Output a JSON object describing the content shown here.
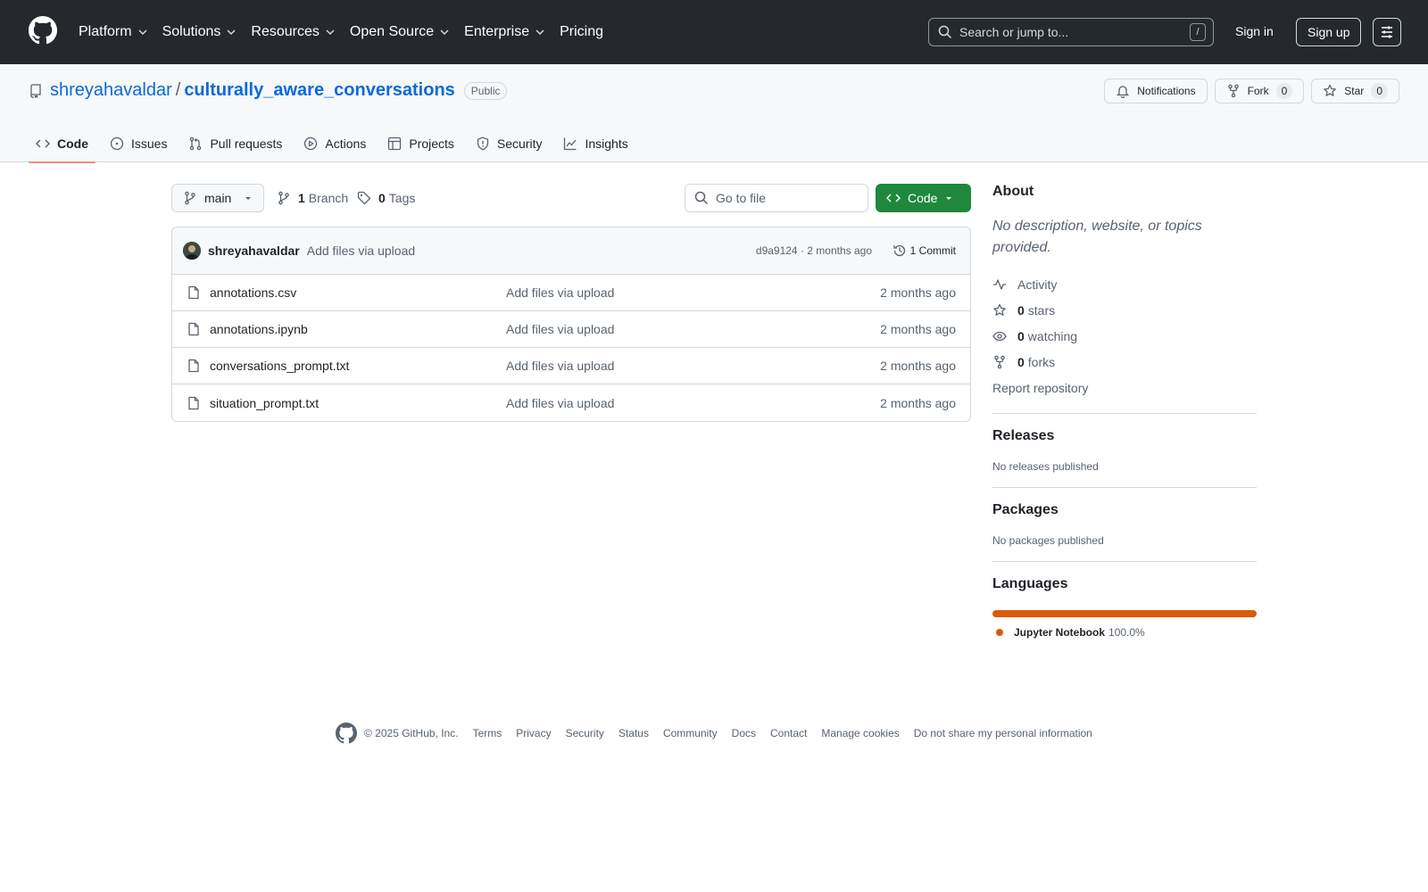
{
  "header": {
    "nav": [
      "Platform",
      "Solutions",
      "Resources",
      "Open Source",
      "Enterprise",
      "Pricing"
    ],
    "nav_dropdown": [
      true,
      true,
      true,
      true,
      true,
      false
    ],
    "search_placeholder": "Search or jump to...",
    "search_shortcut": "/",
    "sign_in": "Sign in",
    "sign_up": "Sign up"
  },
  "repo": {
    "owner": "shreyahavaldar",
    "separator": "/",
    "name": "culturally_aware_conversations",
    "visibility": "Public",
    "notifications_label": "Notifications",
    "fork_label": "Fork",
    "fork_count": "0",
    "star_label": "Star",
    "star_count": "0"
  },
  "tabs": [
    {
      "label": "Code",
      "icon": "code-icon",
      "active": true
    },
    {
      "label": "Issues",
      "icon": "issue-icon",
      "active": false
    },
    {
      "label": "Pull requests",
      "icon": "pull-request-icon",
      "active": false
    },
    {
      "label": "Actions",
      "icon": "play-icon",
      "active": false
    },
    {
      "label": "Projects",
      "icon": "table-icon",
      "active": false
    },
    {
      "label": "Security",
      "icon": "shield-icon",
      "active": false
    },
    {
      "label": "Insights",
      "icon": "graph-icon",
      "active": false
    }
  ],
  "toolbar": {
    "branch": "main",
    "branch_count": "1",
    "branch_label": "Branch",
    "tag_count": "0",
    "tag_label": "Tags",
    "goto_placeholder": "Go to file",
    "code_button": "Code"
  },
  "latest_commit": {
    "author": "shreyahavaldar",
    "message": "Add files via upload",
    "meta": "d9a9124 · 2 months ago",
    "count_label": "1 Commit"
  },
  "files": [
    {
      "name": "annotations.csv",
      "message": "Add files via upload",
      "age": "2 months ago"
    },
    {
      "name": "annotations.ipynb",
      "message": "Add files via upload",
      "age": "2 months ago"
    },
    {
      "name": "conversations_prompt.txt",
      "message": "Add files via upload",
      "age": "2 months ago"
    },
    {
      "name": "situation_prompt.txt",
      "message": "Add files via upload",
      "age": "2 months ago"
    }
  ],
  "sidebar": {
    "about_title": "About",
    "about_desc": "No description, website, or topics provided.",
    "activity": "Activity",
    "stars_count": "0",
    "stars_label": "stars",
    "watching_count": "0",
    "watching_label": "watching",
    "forks_count": "0",
    "forks_label": "forks",
    "report": "Report repository",
    "releases_title": "Releases",
    "releases_sub": "No releases published",
    "packages_title": "Packages",
    "packages_sub": "No packages published",
    "languages_title": "Languages",
    "languages": [
      {
        "name": "Jupyter Notebook",
        "percent": "100.0%",
        "fraction": 1.0,
        "color": "#DA5B0B"
      }
    ]
  },
  "footer": {
    "copyright": "© 2025 GitHub, Inc.",
    "links": [
      "Terms",
      "Privacy",
      "Security",
      "Status",
      "Community",
      "Docs",
      "Contact",
      "Manage cookies",
      "Do not share my personal information"
    ]
  },
  "colors": {
    "header_bg": "#25292e",
    "link": "#0969da",
    "primary_button": "#1f883d",
    "active_tab_underline": "#fd8c73"
  }
}
